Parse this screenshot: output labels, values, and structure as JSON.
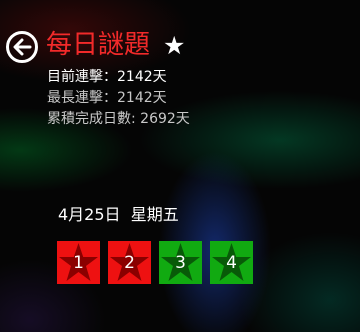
{
  "header": {
    "title": "每日謎題",
    "favorite_icon": "star-icon",
    "back_icon": "back-arrow-icon"
  },
  "stats": {
    "current_streak": "目前連擊：2142天",
    "longest_streak": "最長連擊：2142天",
    "total_days": "累積完成日數: 2692天"
  },
  "puzzle": {
    "date": "4月25日  星期五",
    "levels": [
      {
        "label": "1",
        "status": "incomplete",
        "color": "#ee1111",
        "star_color": "#8a0000"
      },
      {
        "label": "2",
        "status": "incomplete",
        "color": "#ee1111",
        "star_color": "#8a0000"
      },
      {
        "label": "3",
        "status": "completed",
        "color": "#11aa11",
        "star_color": "#085a08"
      },
      {
        "label": "4",
        "status": "completed",
        "color": "#11aa11",
        "star_color": "#085a08"
      }
    ]
  },
  "colors": {
    "title": "#f22a2a",
    "incomplete": "#ee1111",
    "completed": "#11aa11"
  }
}
